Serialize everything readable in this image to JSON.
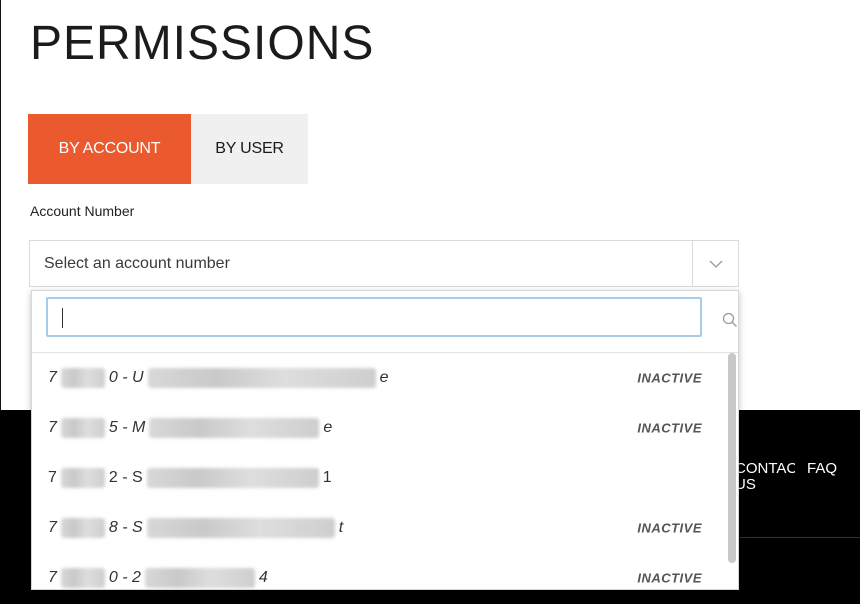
{
  "page": {
    "title": "PERMISSIONS"
  },
  "tabs": [
    {
      "label": "BY ACCOUNT",
      "active": true
    },
    {
      "label": "BY USER",
      "active": false
    }
  ],
  "account_field": {
    "label": "Account Number",
    "placeholder": "Select an account number"
  },
  "dropdown": {
    "search_value": "",
    "options": [
      {
        "prefix": "7",
        "code": "0 - U",
        "suffix": "e",
        "status": "INACTIVE"
      },
      {
        "prefix": "7",
        "code": "5 - M",
        "suffix": "e",
        "status": "INACTIVE"
      },
      {
        "prefix": "7",
        "code": "2 - S",
        "suffix": "1",
        "status": ""
      },
      {
        "prefix": "7",
        "code": "8 - S",
        "suffix": "t",
        "status": "INACTIVE"
      },
      {
        "prefix": "7",
        "code": "0 - 2",
        "suffix": "4",
        "status": "INACTIVE"
      }
    ]
  },
  "footer": {
    "contact_label": "CONTACT US",
    "faq_label": "FAQ"
  },
  "colors": {
    "accent": "#ea5a2e",
    "tab_inactive": "#f0f0f0",
    "footer_bg": "#000000",
    "focus_border": "#a9cbe6"
  },
  "icons": {
    "select_arrow": "chevron-down-icon",
    "search": "search-icon"
  }
}
